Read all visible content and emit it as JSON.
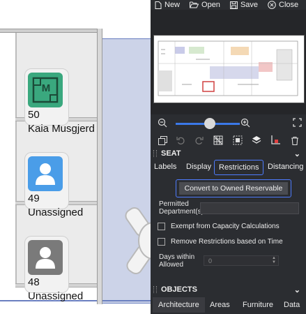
{
  "toolbar": {
    "new_label": "New",
    "open_label": "Open",
    "save_label": "Save",
    "close_label": "Close"
  },
  "seats": [
    {
      "number": "50",
      "name": "Kaia Musgjerd",
      "icon": "person-m-icon",
      "color": "#3aa87e"
    },
    {
      "number": "49",
      "name": "Unassigned",
      "icon": "person-icon",
      "color": "#4a9de8"
    },
    {
      "number": "48",
      "name": "Unassigned",
      "icon": "person-icon",
      "color": "#7a7a7a"
    }
  ],
  "seat_section": {
    "title": "SEAT",
    "tabs": [
      "Labels",
      "Display",
      "Restrictions",
      "Distancing"
    ],
    "active_tab": "Restrictions",
    "convert_button": "Convert to Owned Reservable",
    "permitted_label": "Permitted Department(s)",
    "permitted_value": "",
    "exempt_label": "Exempt from Capacity Calculations",
    "remove_label": "Remove Restrictions based on Time",
    "days_label": "Days within Allowed",
    "days_value": "0"
  },
  "objects_section": {
    "title": "OBJECTS",
    "tabs": [
      "Architecture",
      "Areas",
      "Furniture",
      "Data"
    ],
    "active_tab": "Architecture"
  },
  "colors": {
    "accent": "#4e7cff",
    "panel_bg": "#2b2d31",
    "room_fill": "#ccd3e8"
  }
}
